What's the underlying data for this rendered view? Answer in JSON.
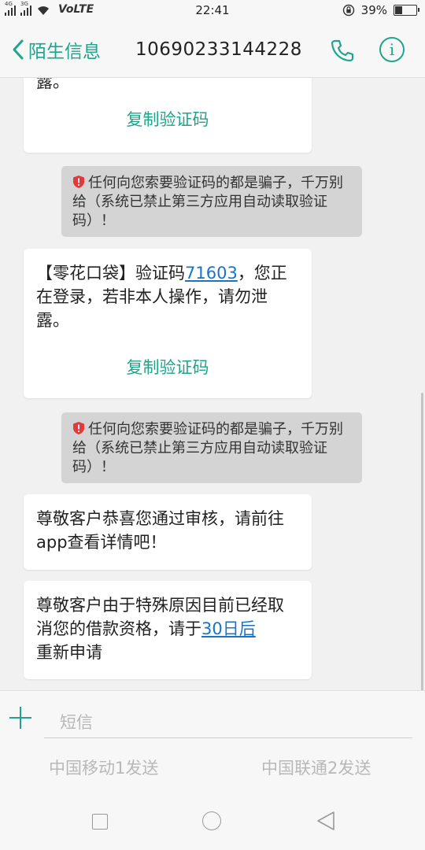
{
  "status": {
    "net1": "4G",
    "net2": "3G",
    "volte": "VoLTE",
    "time": "22:41",
    "battery": "39%",
    "battery_level": 0.39
  },
  "header": {
    "back_label": "陌生信息",
    "sender": "10690233144228"
  },
  "messages": [
    {
      "type": "sms",
      "text": "露。",
      "copy_label": "复制验证码"
    },
    {
      "type": "warning",
      "text": "任何向您索要验证码的都是骗子，千万别给（系统已禁止第三方应用自动读取验证码）！"
    },
    {
      "type": "sms",
      "text_before": "【零花口袋】验证码",
      "code": "71603",
      "text_after": "，您正在登录，若非本人操作，请勿泄露。",
      "copy_label": "复制验证码"
    },
    {
      "type": "warning",
      "text": "任何向您索要验证码的都是骗子，千万别给（系统已禁止第三方应用自动读取验证码）！"
    },
    {
      "type": "sms",
      "text": "尊敬客户恭喜您通过审核，请前往app查看详情吧！"
    },
    {
      "type": "sms",
      "text_before": "尊敬客户由于特殊原因目前已经取消您的借款资格，请于",
      "link": "30日后",
      "text_after": "重新申请"
    }
  ],
  "input": {
    "placeholder": "短信",
    "send_sim1": "中国移动1发送",
    "send_sim2": "中国联通2发送"
  },
  "colors": {
    "accent": "#1fa58b",
    "link": "#1a73c8",
    "warning_bg": "#d4d4d4",
    "warning_icon": "#e23a3a"
  }
}
